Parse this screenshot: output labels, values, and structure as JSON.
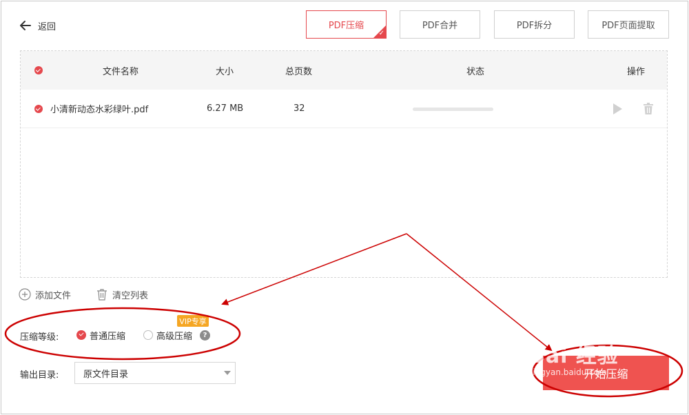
{
  "header": {
    "back_label": "返回",
    "tabs": [
      {
        "label": "PDF压缩",
        "active": true
      },
      {
        "label": "PDF合并",
        "active": false
      },
      {
        "label": "PDF拆分",
        "active": false
      },
      {
        "label": "PDF页面提取",
        "active": false
      }
    ]
  },
  "table": {
    "columns": {
      "name": "文件名称",
      "size": "大小",
      "pages": "总页数",
      "status": "状态",
      "action": "操作"
    },
    "rows": [
      {
        "name": "小清新动态水彩绿叶.pdf",
        "size": "6.27 MB",
        "pages": "32",
        "progress": 0
      }
    ]
  },
  "actions": {
    "add_file": "添加文件",
    "clear_list": "清空列表"
  },
  "compression": {
    "label": "压缩等级:",
    "options": [
      {
        "label": "普通压缩",
        "selected": true
      },
      {
        "label": "高级压缩",
        "selected": false
      }
    ],
    "vip_badge": "VIP专享",
    "help": "?"
  },
  "output": {
    "label": "输出目录:",
    "value": "原文件目录"
  },
  "start_button": "开始压缩",
  "watermark": {
    "main": "Bai 经验",
    "sub": "jingyan.baidu.com"
  },
  "colors": {
    "accent": "#e5484d",
    "vip": "#f5a623",
    "annotation": "#cc0000"
  }
}
